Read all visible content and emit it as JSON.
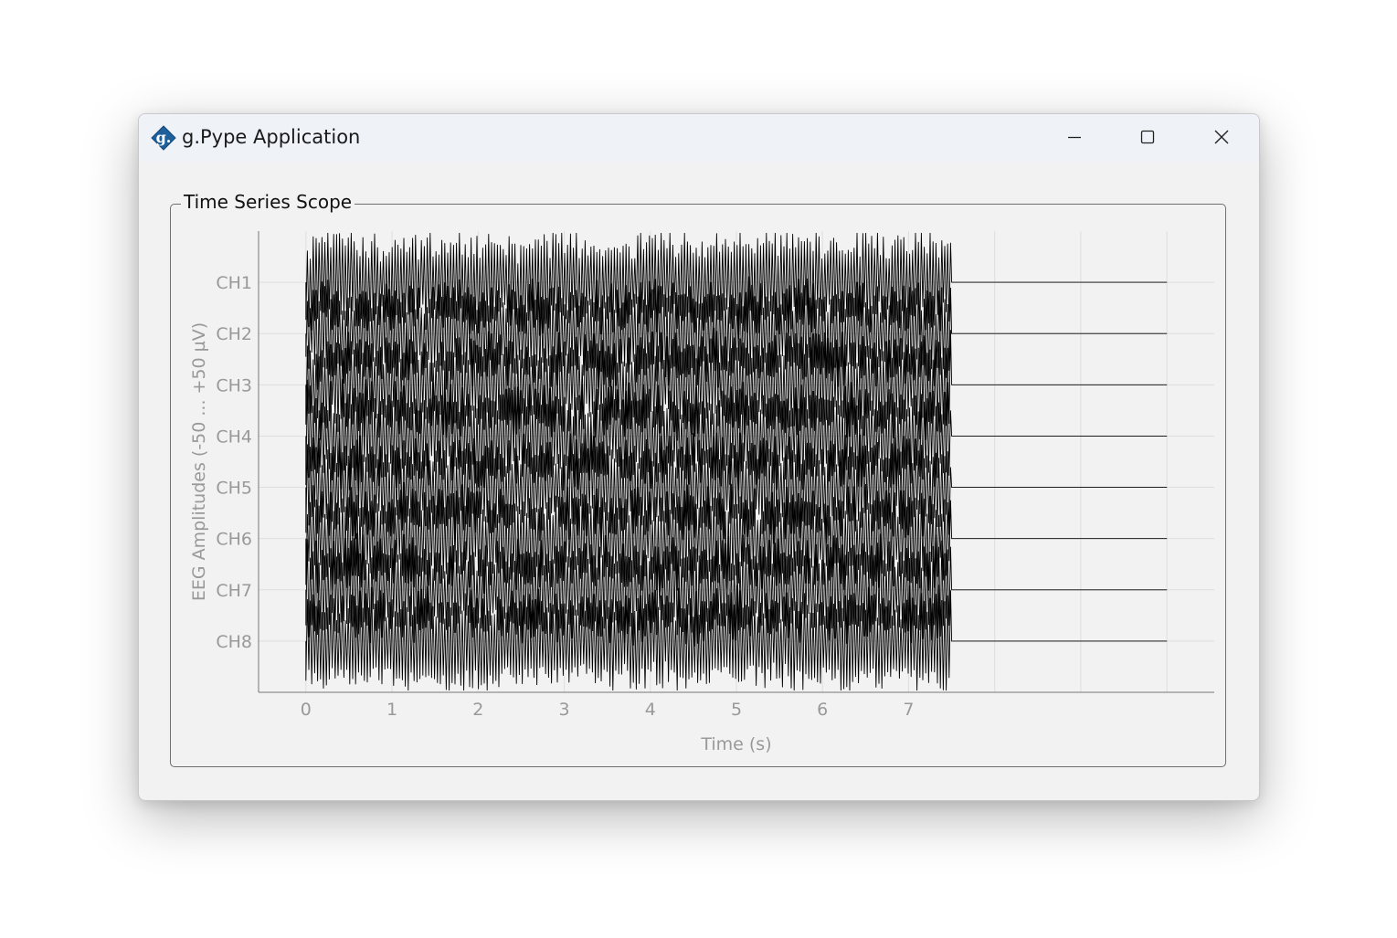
{
  "window": {
    "title": "g.Pype Application",
    "icon": "g-logo-icon",
    "controls": [
      "minimize-icon",
      "maximize-icon",
      "close-icon"
    ]
  },
  "group": {
    "label": "Time Series Scope"
  },
  "chart_data": {
    "type": "line",
    "xlabel": "Time (s)",
    "ylabel": "EEG Amplitudes (-50 ... +50 µV)",
    "x_ticks": [
      "0",
      "1",
      "2",
      "3",
      "4",
      "5",
      "6",
      "7"
    ],
    "xlim": [
      -0.55,
      10.55
    ],
    "channels": [
      "CH1",
      "CH2",
      "CH3",
      "CH4",
      "CH5",
      "CH6",
      "CH7",
      "CH8"
    ],
    "signal_end_s": 7.5,
    "flat_end_s": 10.0,
    "amplitude_range_uV": [
      -50,
      50
    ],
    "grid": true,
    "line_color": "#000000",
    "grid_color": "#dedede",
    "axis_text_color": "#999999"
  }
}
